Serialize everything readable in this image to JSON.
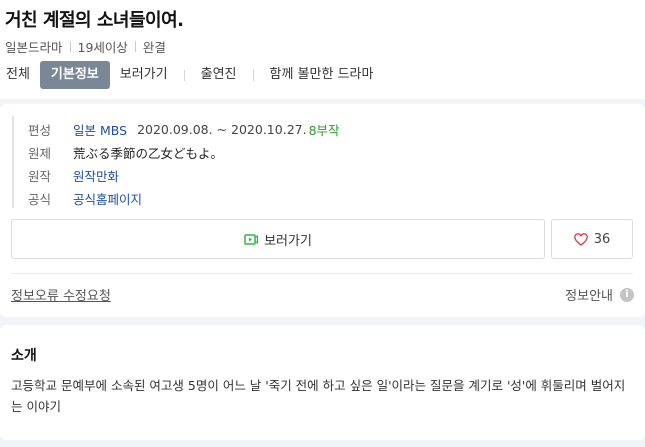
{
  "header": {
    "title": "거친 계절의 소녀들이여.",
    "meta": [
      "일본드라마",
      "19세이상",
      "완결"
    ],
    "tabs": [
      "전체",
      "기본정보",
      "보러가기",
      "출연진",
      "함께 볼만한 드라마"
    ],
    "active_tab": "기본정보"
  },
  "info": {
    "rows": [
      {
        "key": "편성",
        "broadcaster": "일본 MBS",
        "date": "2020.09.08. ~ 2020.10.27.",
        "episodes": "8부작"
      },
      {
        "key": "원제",
        "value": "荒ぶる季節の乙女どもよ。"
      },
      {
        "key": "원작",
        "value": "원작만화"
      },
      {
        "key": "공식",
        "value": "공식홈페이지"
      }
    ],
    "watch_label": "보러가기",
    "like_count": "36",
    "fix_request": "정보오류 수정요청",
    "guide": "정보안내",
    "guide_icon": "i"
  },
  "intro": {
    "title": "소개",
    "text": "고등학교 문예부에 소속된 여고생 5명이 어느 날 '죽기 전에 하고 싶은 일'이라는 질문을 계기로 '성'에 휘둘리며 벌어지는 이야기"
  },
  "colors": {
    "tab_active_bg": "#7a8797",
    "link": "#1f4fa0",
    "episode": "#2a9d2a",
    "watch_icon": "#2dbb3c",
    "heart": "#e0414b"
  }
}
